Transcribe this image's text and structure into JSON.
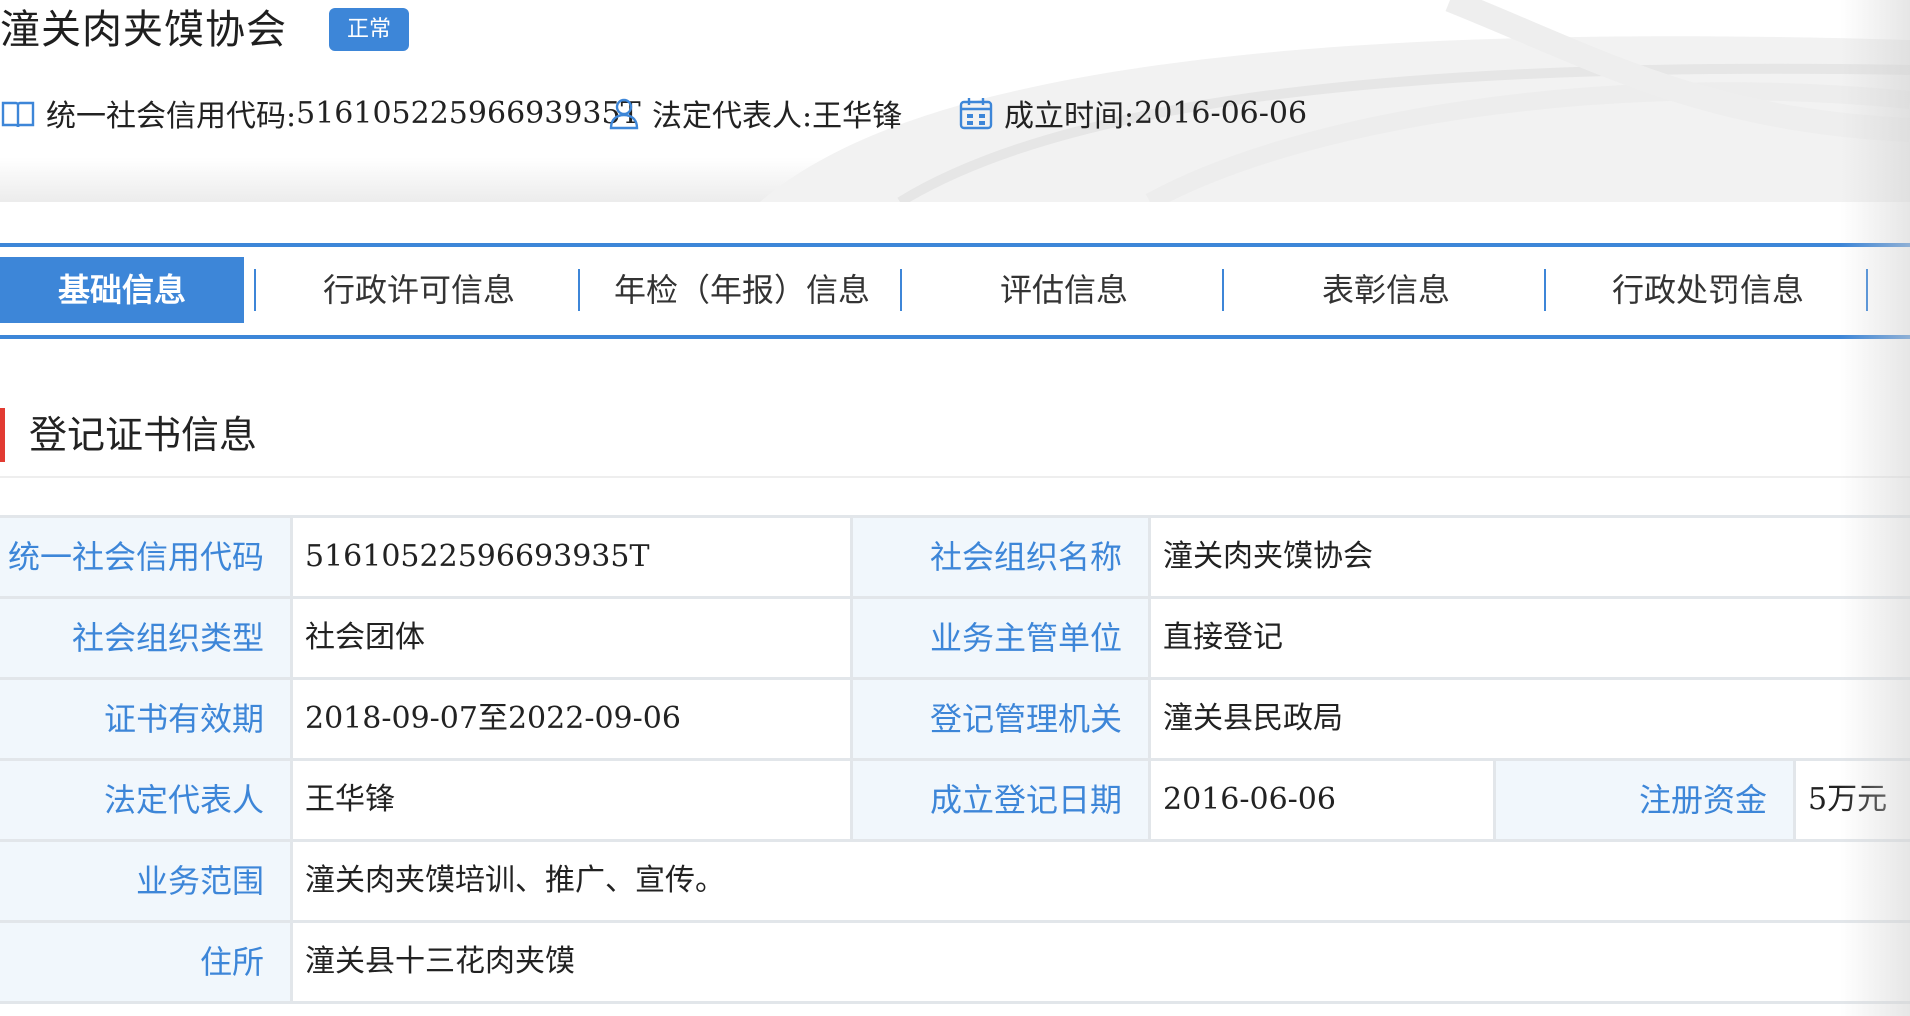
{
  "header": {
    "org_name": "潼关肉夹馍协会",
    "status": "正常",
    "credit_code_label": "统一社会信用代码:",
    "credit_code": "51610522596693935T",
    "legal_rep_label": "法定代表人:",
    "legal_rep": "王华锋",
    "founded_label": "成立时间:",
    "founded": "2016-06-06",
    "icons": [
      "book-icon",
      "user-icon",
      "calendar-icon"
    ]
  },
  "tabs": [
    {
      "label": "基础信息",
      "active": true
    },
    {
      "label": "行政许可信息"
    },
    {
      "label": "年检（年报）信息"
    },
    {
      "label": "评估信息"
    },
    {
      "label": "表彰信息"
    },
    {
      "label": "行政处罚信息"
    }
  ],
  "section": {
    "title": "登记证书信息"
  },
  "table": {
    "rows": [
      {
        "l1": "统一社会信用代码",
        "v1": "51610522596693935T",
        "l2": "社会组织名称",
        "v2": "潼关肉夹馍协会"
      },
      {
        "l1": "社会组织类型",
        "v1": "社会团体",
        "l2": "业务主管单位",
        "v2": "直接登记"
      },
      {
        "l1": "证书有效期",
        "v1": "2018-09-07至2022-09-06",
        "l2": "登记管理机关",
        "v2": "潼关县民政局"
      },
      {
        "l1": "法定代表人",
        "v1": "王华锋",
        "l2": "成立登记日期",
        "v2": "2016-06-06",
        "l3": "注册资金",
        "v3": "5万元"
      },
      {
        "l1": "业务范围",
        "v1": "潼关肉夹馍培训、推广、宣传。"
      },
      {
        "l1": "住所",
        "v1": "潼关县十三花肉夹馍"
      }
    ]
  },
  "colors": {
    "accent": "#3d86d8",
    "section_marker": "#e23b32",
    "label_bg": "#f1f7fc"
  }
}
